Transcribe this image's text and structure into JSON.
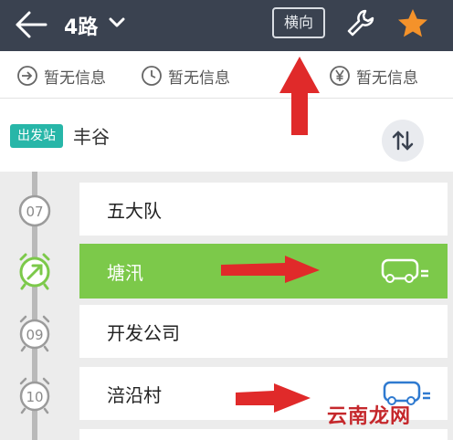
{
  "header": {
    "route_title": "4路",
    "orientation_label": "横向"
  },
  "info": {
    "first_bus": "暂无信息",
    "time": "暂无信息",
    "fare": "暂无信息"
  },
  "origin": {
    "tag": "出发站",
    "name": "丰谷"
  },
  "stops": [
    {
      "index": "07",
      "name": "五大队",
      "active": false
    },
    {
      "index": "",
      "name": "塘汛",
      "active": true
    },
    {
      "index": "09",
      "name": "开发公司",
      "active": false
    },
    {
      "index": "10",
      "name": "涪沿村",
      "active": false
    }
  ],
  "watermark": "云南龙网",
  "colors": {
    "topbar": "#3a4250",
    "active_stop": "#7cc94a",
    "origin_tag": "#27b6a8",
    "star": "#f4922a",
    "arrow": "#e02a2a",
    "bus_blue": "#2f7ad0"
  }
}
